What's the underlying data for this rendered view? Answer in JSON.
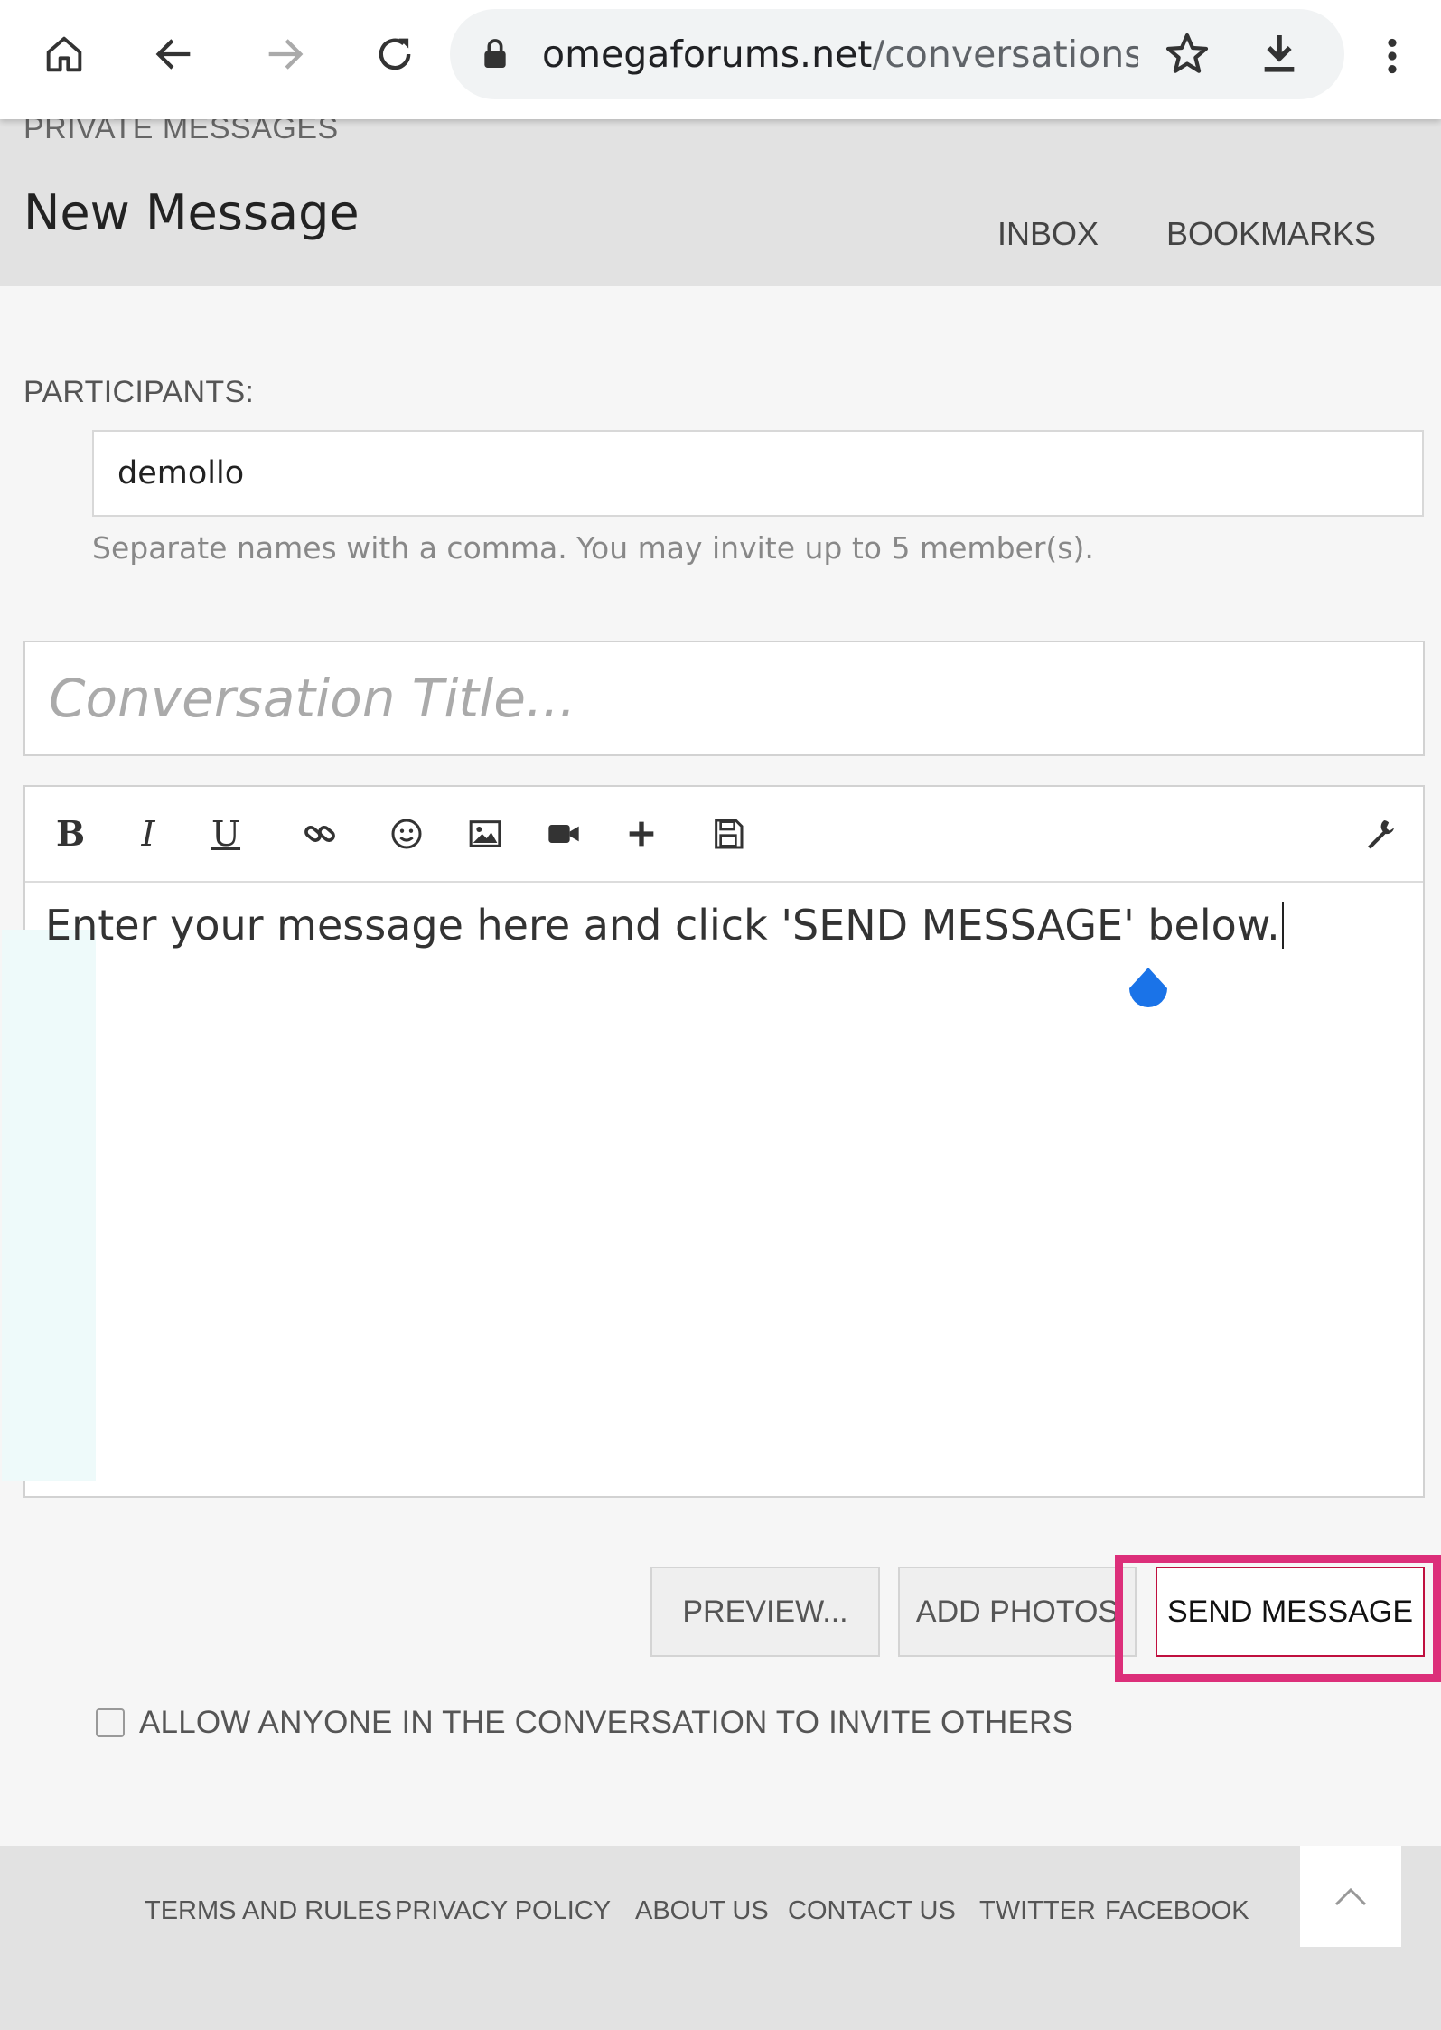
{
  "browser": {
    "url_host": "omegaforums.net",
    "url_path": "/conversations/ad"
  },
  "header": {
    "breadcrumb": "PRIVATE MESSAGES",
    "title": "New Message",
    "nav": [
      "INBOX",
      "BOOKMARKS"
    ]
  },
  "form": {
    "participants_label": "PARTICIPANTS:",
    "participants_value": "demollo",
    "participants_hint": "Separate names with a comma. You may invite up to 5 member(s).",
    "title_placeholder": "Conversation Title...",
    "editor_text": "Enter your message here and click 'SEND MESSAGE' below.",
    "toolbar_icons": [
      "bold-icon",
      "italic-icon",
      "underline-icon",
      "link-icon",
      "smilie-icon",
      "image-icon",
      "video-icon",
      "insert-icon",
      "save-draft-icon",
      "wrench-icon"
    ],
    "buttons": {
      "preview": "PREVIEW...",
      "add_photos": "ADD PHOTOS",
      "send": "SEND MESSAGE"
    },
    "invite_label": "ALLOW ANYONE IN THE CONVERSATION TO INVITE OTHERS",
    "invite_checked": false
  },
  "footer": {
    "links": [
      "TERMS AND RULES",
      "PRIVACY POLICY",
      "ABOUT US",
      "CONTACT US",
      "TWITTER",
      "FACEBOOK"
    ]
  },
  "colors": {
    "highlight": "#dc2f7a",
    "send_border": "#c0103f",
    "caret_handle": "#1a73e8"
  }
}
